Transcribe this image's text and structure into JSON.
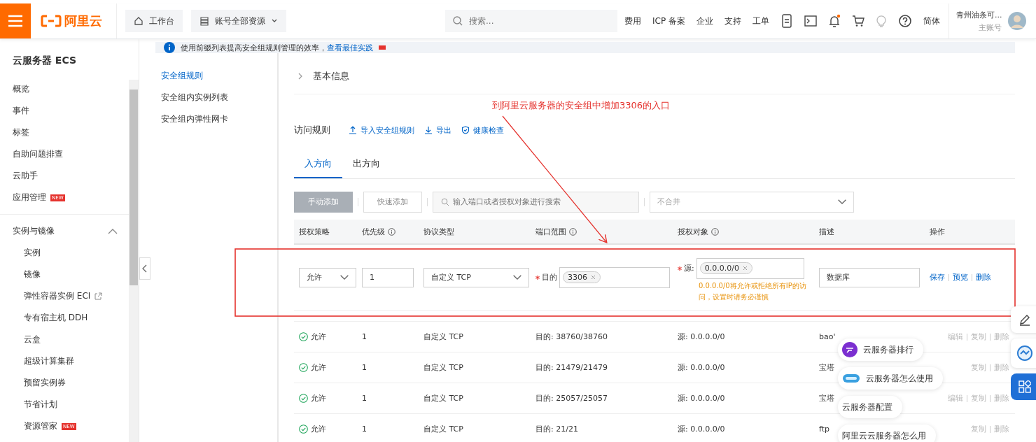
{
  "topbar": {
    "logo": "阿里云",
    "workbench": "工作台",
    "resources": "账号全部资源",
    "search": {
      "placeholder": "搜索..."
    },
    "links": [
      "费用",
      "ICP 备案",
      "企业",
      "支持",
      "工单"
    ],
    "language": "简体",
    "account": {
      "name": "青州油条可...",
      "role": "主账号"
    }
  },
  "sidebar": {
    "title": "云服务器 ECS",
    "items": [
      {
        "label": "概览"
      },
      {
        "label": "事件"
      },
      {
        "label": "标签"
      },
      {
        "label": "自助问题排查"
      },
      {
        "label": "云助手"
      },
      {
        "label": "应用管理",
        "badge": "NEW"
      }
    ],
    "groups": [
      {
        "label": "实例与镜像",
        "expanded": true,
        "children": [
          {
            "label": "实例"
          },
          {
            "label": "镜像"
          },
          {
            "label": "弹性容器实例 ECI",
            "external": true
          },
          {
            "label": "专有宿主机 DDH"
          },
          {
            "label": "云盒"
          },
          {
            "label": "超级计算集群"
          },
          {
            "label": "预留实例券"
          },
          {
            "label": "节省计划"
          },
          {
            "label": "资源管家",
            "badge": "NEW"
          }
        ]
      }
    ]
  },
  "banner": {
    "text": "使用前缀列表提高安全组规则管理的效率，",
    "link": "查看最佳实践"
  },
  "subnav": [
    {
      "label": "安全组规则",
      "selected": true
    },
    {
      "label": "安全组内实例列表",
      "selected": false
    },
    {
      "label": "安全组内弹性网卡",
      "selected": false
    }
  ],
  "section": {
    "label": "基本信息",
    "expanded": false
  },
  "rules": {
    "title": "访问规则",
    "actions": [
      {
        "label": "导入安全组规则",
        "kind": "upload"
      },
      {
        "label": "导出",
        "kind": "download"
      },
      {
        "label": "健康检查",
        "kind": "shield"
      }
    ],
    "tabs": [
      {
        "label": "入方向",
        "selected": true
      },
      {
        "label": "出方向",
        "selected": false
      }
    ],
    "toolbar": {
      "manual_add": "手动添加",
      "quick_add": "快速添加",
      "search": {
        "placeholder": "输入端口或者授权对象进行搜索"
      },
      "merge": {
        "placeholder": "不合并"
      }
    },
    "columns": [
      {
        "label": "授权策略",
        "info": false
      },
      {
        "label": "优先级",
        "info": true
      },
      {
        "label": "协议类型",
        "info": false
      },
      {
        "label": "端口范围",
        "info": true
      },
      {
        "label": "授权对象",
        "info": true
      },
      {
        "label": "描述",
        "info": false
      },
      {
        "label": "操作",
        "info": false
      }
    ],
    "edit_row": {
      "policy": "允许",
      "priority": "1",
      "protocol": "自定义 TCP",
      "dest_label": "目的",
      "dest_tag": "3306",
      "source_label": "源:",
      "source_tag": "0.0.0.0/0",
      "warning": "0.0.0.0/0将允许或拒绝所有IP的访问，设置时请务必谨慎",
      "description": "数据库",
      "actions": [
        "保存",
        "预览",
        "删除"
      ]
    },
    "rows": [
      {
        "policy": "允许",
        "priority": "1",
        "protocol": "自定义 TCP",
        "port": "目的: 38760/38760",
        "source": "源: 0.0.0.0/0",
        "description": "bao'",
        "actions": [
          "编辑",
          "复制",
          "删除"
        ],
        "disabled": true
      },
      {
        "policy": "允许",
        "priority": "1",
        "protocol": "自定义 TCP",
        "port": "目的: 21479/21479",
        "source": "源: 0.0.0.0/0",
        "description": "宝塔",
        "actions": [
          "复制",
          "删除"
        ],
        "disabled": true
      },
      {
        "policy": "允许",
        "priority": "1",
        "protocol": "自定义 TCP",
        "port": "目的: 25057/25057",
        "source": "源: 0.0.0.0/0",
        "description": "宝塔",
        "actions": [
          "编辑",
          "复制",
          "删除"
        ],
        "disabled": true
      },
      {
        "policy": "允许",
        "priority": "1",
        "protocol": "自定义 TCP",
        "port": "目的: 21/21",
        "source": "源: 0.0.0.0/0",
        "description": "ftp",
        "actions": [
          "复制",
          "删除"
        ],
        "disabled": true
      }
    ]
  },
  "annotation": {
    "text": "到阿里云服务器的安全组中增加3306的入口"
  },
  "suggestions": [
    {
      "label": "云服务器排行",
      "kind": "purple"
    },
    {
      "label": "云服务器怎么使用",
      "kind": "blue"
    },
    {
      "label": "云服务器配置",
      "kind": "none"
    },
    {
      "label": "阿里云云服务器怎么用",
      "kind": "none"
    }
  ]
}
